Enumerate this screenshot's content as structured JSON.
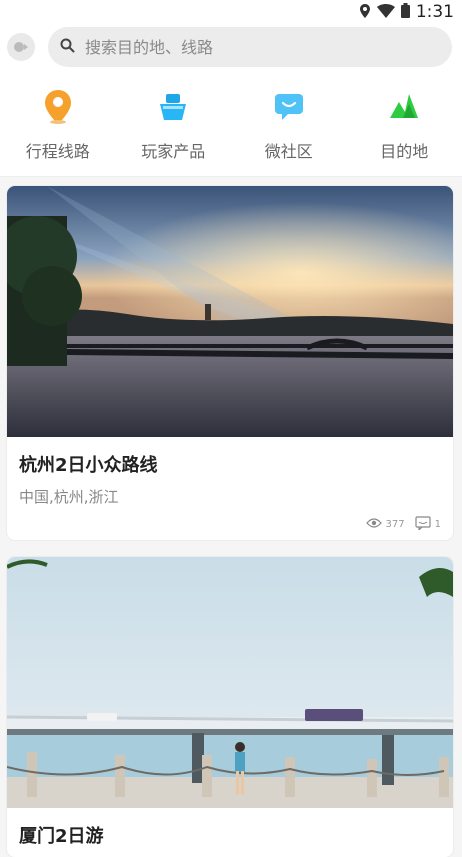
{
  "status": {
    "time": "1:31"
  },
  "search": {
    "placeholder": "搜索目的地、线路"
  },
  "nav": [
    {
      "label": "行程线路",
      "icon": "location-pin-icon",
      "color": "#f5a623"
    },
    {
      "label": "玩家产品",
      "icon": "boat-icon",
      "color": "#29b6f6"
    },
    {
      "label": "微社区",
      "icon": "chat-bubble-icon",
      "color": "#4fc3f7"
    },
    {
      "label": "目的地",
      "icon": "mountain-icon",
      "color": "#2ecc40"
    }
  ],
  "cards": [
    {
      "title": "杭州2日小众路线",
      "location": "中国,杭州,浙江",
      "views": "377",
      "comments": "1"
    },
    {
      "title": "厦门2日游"
    }
  ]
}
